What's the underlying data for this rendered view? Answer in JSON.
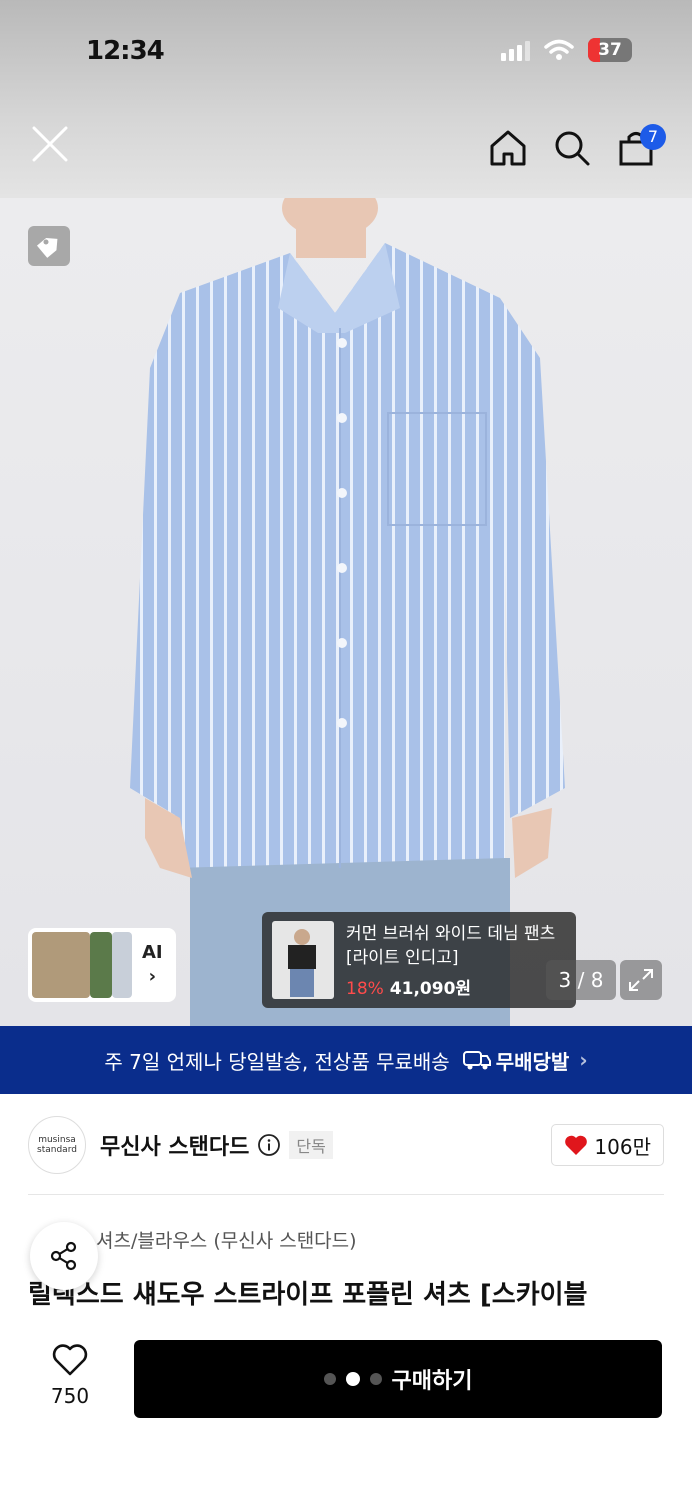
{
  "status": {
    "time": "12:34",
    "battery": "37"
  },
  "nav": {
    "cart_count": "7"
  },
  "hero": {
    "ai_label": "AI",
    "promo_name": "커먼 브러쉬 와이드 데님 팬츠 [라이트 인디고]",
    "promo_discount": "18%",
    "promo_price": "41,090원",
    "image_counter": "3 / 8"
  },
  "banner": {
    "text": "주 7일 언제나 당일발송, 전상품 무료배송",
    "badge": "무배당발"
  },
  "brand": {
    "logo_line1": "musinsa",
    "logo_line2": "standard",
    "name": "무신사 스탠다드",
    "exclusive": "단독",
    "likes": "106만"
  },
  "product": {
    "breadcrumb": "셔츠/블라우스 (무신사 스탠다드)",
    "title": "릴렉스드 섀도우 스트라이프 포플린 셔츠 [스카이블"
  },
  "bottom": {
    "wish_count": "750",
    "buy_label": "구매하기"
  },
  "colors": {
    "banner": "#0a2d8c",
    "badge": "#1d5be8",
    "discount": "#ff4b4b"
  }
}
